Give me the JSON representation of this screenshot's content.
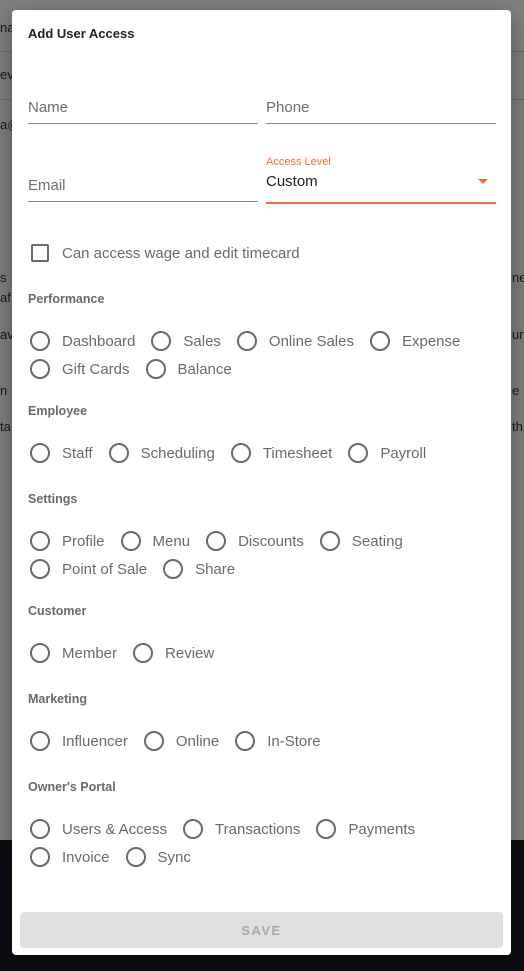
{
  "background": {
    "fragments_left": [
      "na",
      "evi",
      "a@",
      "s",
      "af",
      "av",
      "n",
      "ta"
    ],
    "fragments_right": [
      "ne",
      "ur",
      "e",
      "th"
    ]
  },
  "dialog": {
    "title": "Add User Access",
    "fields": {
      "name": {
        "placeholder": "Name",
        "value": ""
      },
      "phone": {
        "placeholder": "Phone",
        "value": ""
      },
      "email": {
        "placeholder": "Email",
        "value": ""
      }
    },
    "access_level": {
      "label": "Access Level",
      "value": "Custom"
    },
    "wage_checkbox": {
      "label": "Can access wage and edit timecard",
      "checked": false
    },
    "sections": [
      {
        "title": "Performance",
        "options": [
          "Dashboard",
          "Sales",
          "Online Sales",
          "Expense",
          "Gift Cards",
          "Balance"
        ]
      },
      {
        "title": "Employee",
        "options": [
          "Staff",
          "Scheduling",
          "Timesheet",
          "Payroll"
        ]
      },
      {
        "title": "Settings",
        "options": [
          "Profile",
          "Menu",
          "Discounts",
          "Seating",
          "Point of Sale",
          "Share"
        ]
      },
      {
        "title": "Customer",
        "options": [
          "Member",
          "Review"
        ]
      },
      {
        "title": "Marketing",
        "options": [
          "Influencer",
          "Online",
          "In-Store"
        ]
      },
      {
        "title": "Owner's Portal",
        "options": [
          "Users & Access",
          "Transactions",
          "Payments",
          "Invoice",
          "Sync"
        ]
      }
    ],
    "save_label": "SAVE"
  },
  "colors": {
    "accent": "#f26b36",
    "text_muted": "#6a6a6a",
    "disabled_button_bg": "#e0e0e0",
    "disabled_button_text": "#a8a8a8"
  }
}
